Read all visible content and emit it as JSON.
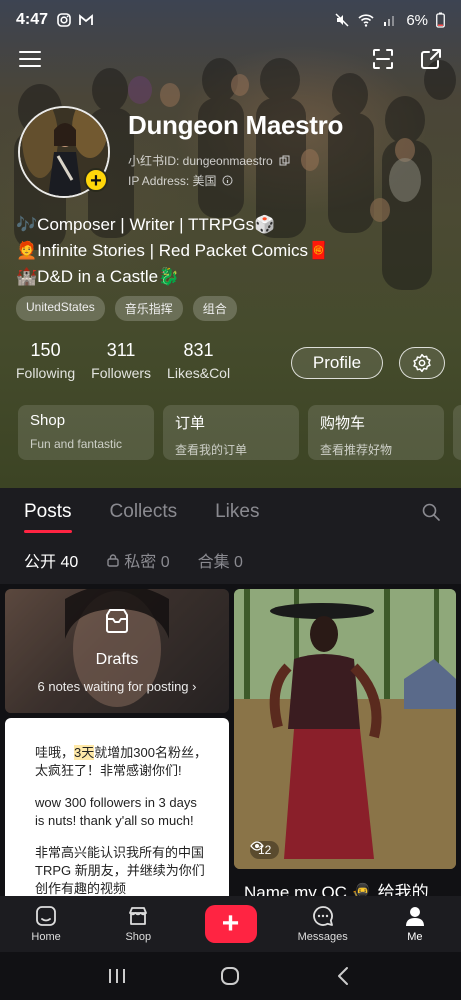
{
  "status_bar": {
    "time": "4:47",
    "battery": "6%"
  },
  "profile": {
    "name": "Dungeon Maestro",
    "id_label": "小红书ID: dungeonmaestro",
    "ip_label": "IP Address: 美国",
    "bio": [
      "🎶Composer | Writer | TTRPGs🎲",
      "🧑‍🦰Infinite Stories | Red Packet Comics🧧",
      "🏰D&D in a Castle🐉"
    ],
    "tags": [
      "UnitedStates",
      "音乐指挥",
      "组合"
    ],
    "stats": [
      {
        "value": "150",
        "label": "Following"
      },
      {
        "value": "311",
        "label": "Followers"
      },
      {
        "value": "831",
        "label": "Likes&Col"
      }
    ],
    "profile_button": "Profile"
  },
  "shortcut_cards": [
    {
      "title": "Shop",
      "subtitle": "Fun and fantastic"
    },
    {
      "title": "订单",
      "subtitle": "查看我的订单"
    },
    {
      "title": "购物车",
      "subtitle": "查看推荐好物"
    }
  ],
  "tabs": [
    "Posts",
    "Collects",
    "Likes"
  ],
  "subtabs": [
    {
      "label": "公开 40"
    },
    {
      "label": "私密 0"
    },
    {
      "label": "合集 0"
    }
  ],
  "feed": {
    "drafts": {
      "title": "Drafts",
      "subtitle": "6 notes waiting for posting ›"
    },
    "note": {
      "line1_pre": "哇哦，",
      "line1_hl": "3天",
      "line1_post": "就增加300名粉丝，太疯狂了！非常感谢你们!",
      "line2": "wow 300 followers in 3 days is nuts! thank y'all so much!",
      "line3": "非常高兴能认识我所有的中国 TRPG 新朋友，并继续为你们创作有趣的视频"
    },
    "photo_post": {
      "views": "12",
      "caption": "Name my OC 🥷 给我的"
    }
  },
  "bottom_nav": {
    "home": "Home",
    "shop": "Shop",
    "plus": "+",
    "messages": "Messages",
    "me": "Me"
  },
  "colors": {
    "accent": "#ff2442",
    "avatar_badge": "#ffd60a"
  }
}
